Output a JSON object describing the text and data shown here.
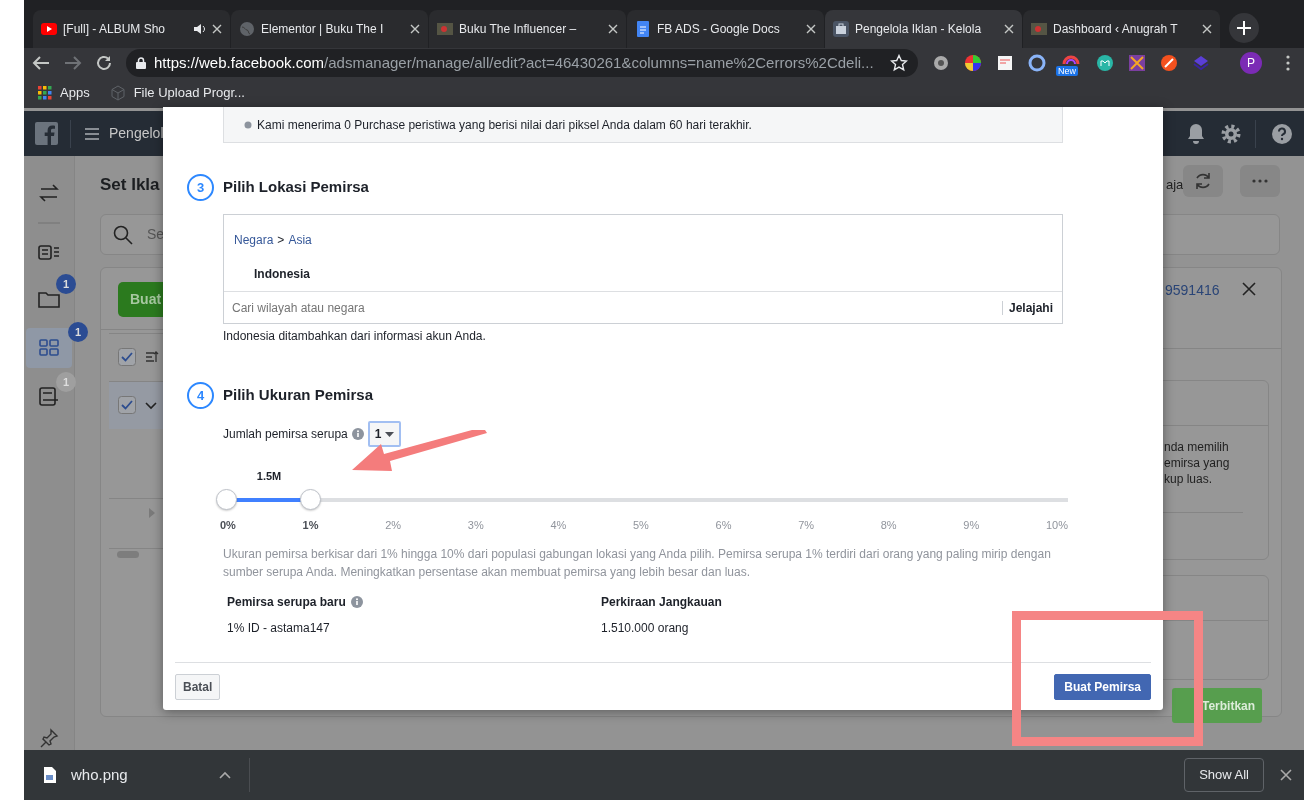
{
  "browser": {
    "tabs": [
      {
        "title": "[Full] - ALBUM Sho",
        "kind": "youtube",
        "audio": true,
        "selected": false
      },
      {
        "title": "Elementor | Buku The I",
        "kind": "globe",
        "audio": false,
        "selected": false
      },
      {
        "title": "Buku The Influencer –",
        "kind": "image",
        "audio": false,
        "selected": false
      },
      {
        "title": "FB ADS - Google Docs",
        "kind": "docs",
        "audio": false,
        "selected": false
      },
      {
        "title": "Pengelola Iklan - Kelola",
        "kind": "ads",
        "audio": false,
        "selected": true
      },
      {
        "title": "Dashboard ‹ Anugrah T",
        "kind": "image",
        "audio": false,
        "selected": false
      }
    ],
    "url": {
      "scheme": "https://",
      "host": "web.facebook.com",
      "path": "/adsmanager/manage/all/edit?act=46430261&columns=name%2Cerrors%2Cdeli..."
    },
    "extension_badge": "New",
    "profile_initial": "P",
    "bookmarks": [
      {
        "kind": "apps",
        "label": "Apps"
      },
      {
        "kind": "cube",
        "label": "File Upload Progr..."
      }
    ]
  },
  "app": {
    "header_title": "Pengelol",
    "page_title": "Set Ikla",
    "search_placeholder": "Se",
    "create_button": "Buat",
    "toolbar_text": "aja",
    "panel_id": "9591416",
    "sidebar": [
      {
        "kind": "swap",
        "selected": false
      },
      {
        "kind": "ads",
        "selected": false
      },
      {
        "kind": "folder",
        "badge": "1",
        "color": "#2b4c93",
        "selected": false
      },
      {
        "kind": "grid",
        "badge": "1",
        "color": "#2b4c93",
        "selected": true
      },
      {
        "kind": "doc",
        "badge": "1",
        "color": "#9f9f9f",
        "selected": false
      }
    ],
    "rows": [
      {
        "kind": "header",
        "checked": true,
        "selected": false
      },
      {
        "kind": "item",
        "checked": true,
        "selected": true
      }
    ],
    "panel_text": [
      "nda memilih",
      "emirsa yang",
      "kup luas."
    ],
    "publish_button": "Terbitkan"
  },
  "modal": {
    "events_note": "Kami menerima 0 Purchase peristiwa yang berisi nilai dari piksel Anda dalam 60 hari terakhir.",
    "location": {
      "number": "3",
      "title": "Pilih Lokasi Pemirsa",
      "breadcrumb": [
        "Negara",
        "Asia"
      ],
      "separator": ">",
      "country": "Indonesia",
      "search_placeholder": "Cari wilayah atau negara",
      "browse": "Jelajahi",
      "note": "Indonesia ditambahkan dari informasi akun Anda."
    },
    "size": {
      "number": "4",
      "title": "Pilih Ukuran Pemirsa",
      "count_label": "Jumlah pemirsa serupa",
      "count_value": "1",
      "slider": {
        "level": 0.1,
        "reading": "1.5M",
        "ticks": [
          "0%",
          "1%",
          "2%",
          "3%",
          "4%",
          "5%",
          "6%",
          "7%",
          "8%",
          "9%",
          "10%"
        ]
      },
      "description": "Ukuran pemirsa berkisar dari 1% hingga 10% dari populasi gabungan lokasi yang Anda pilih. Pemirsa serupa 1% terdiri dari orang yang paling mirip dengan sumber serupa Anda. Meningkatkan persentase akan membuat pemirsa yang lebih besar dan luas.",
      "columns": [
        {
          "heading": "Pemirsa serupa baru",
          "info": true,
          "value": "1% ID - astama147"
        },
        {
          "heading": "Perkiraan Jangkauan",
          "info": false,
          "value": "1.510.000 orang"
        }
      ]
    },
    "cancel_button": "Batal",
    "create_button": "Buat Pemirsa"
  },
  "downloads": {
    "file": "who.png",
    "show_all": "Show All"
  }
}
